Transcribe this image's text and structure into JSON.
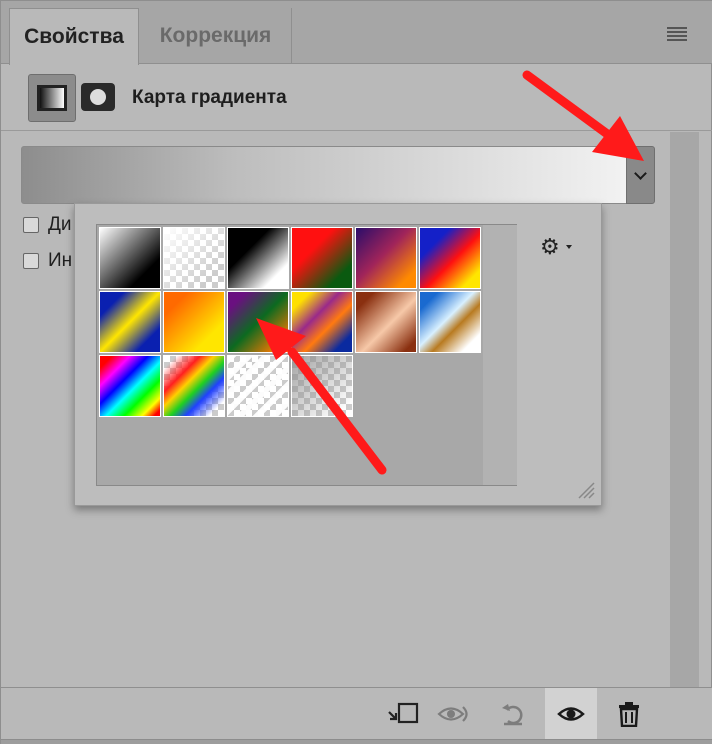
{
  "tabs": [
    {
      "label": "Свойства",
      "active": true
    },
    {
      "label": "Коррекция",
      "active": false
    }
  ],
  "header": {
    "title": "Карта градиента",
    "adjustment_icon": "gradient-map-icon",
    "mask_icon": "mask-icon"
  },
  "gradient": {
    "preview_colors": [
      "#8d8d8d",
      "#f2f2f2"
    ]
  },
  "options": [
    {
      "label": "Ди",
      "checked": false
    },
    {
      "label": "Ин",
      "checked": false
    }
  ],
  "presets": [
    {
      "name": "black-white",
      "css": "linear-gradient(135deg, #fff 0%, #000 75%)"
    },
    {
      "name": "white-transparent",
      "css": "linear-gradient(135deg, #fff 0%, rgba(255,255,255,0) 80%)",
      "checker": true
    },
    {
      "name": "black-white-2",
      "css": "linear-gradient(135deg, #000 35%, #fff 80%)"
    },
    {
      "name": "red-green",
      "css": "linear-gradient(135deg, #ff1010 35%, #0a5a10 80%)"
    },
    {
      "name": "violet-orange",
      "css": "linear-gradient(135deg, #2a0d6a 0%, #a0245a 45%, #ff8a00 85%)"
    },
    {
      "name": "blue-red-yellow",
      "css": "linear-gradient(135deg, #1420c8 25%, #ff1010 55%, #ffe600 85%)"
    },
    {
      "name": "blue-yellow-blue",
      "css": "linear-gradient(135deg, #0a20b0 20%, #ffe600 50%, #0a20b0 80%)"
    },
    {
      "name": "orange-yellow",
      "css": "linear-gradient(135deg, #ff6a00 20%, #ffe600 75%)"
    },
    {
      "name": "violet-green-orange",
      "css": "linear-gradient(135deg, #6a1080 15%, #0c6a20 50%, #ff7a00 90%)"
    },
    {
      "name": "yellow-violet-orange-blue",
      "css": "linear-gradient(135deg, #ffe000 15%, #9a2a8a 40%, #ff7a10 60%, #0a2aa0 85%)"
    },
    {
      "name": "copper",
      "css": "linear-gradient(135deg, #8a3010 15%, #f6c8a8 55%, #8a3010 90%)"
    },
    {
      "name": "chrome",
      "css": "linear-gradient(135deg, #1a6ad0 15%, #d8f0ff 45%, #b87a20 60%, #fff 85%)"
    },
    {
      "name": "spectrum",
      "css": "linear-gradient(135deg, #ff0000 10%, #ff00ff 25%, #0000ff 40%, #00ffff 55%, #00ff00 70%, #ffff00 85%, #ff0000 95%)"
    },
    {
      "name": "transparent-rainbow",
      "css": "linear-gradient(135deg, rgba(255,0,0,0) 10%, #ff2020 30%, #ffd000 42%, #20d020 55%, #2040ff 68%, rgba(0,0,255,0) 88%)",
      "checker": true
    },
    {
      "name": "transparent-stripes",
      "css": "repeating-linear-gradient(135deg, rgba(255,255,255,0.95) 0 6px, rgba(255,255,255,0) 6px 12px)",
      "checker": true
    },
    {
      "name": "neutral-density",
      "css": "linear-gradient(135deg, rgba(140,140,140,0.8) 0%, rgba(140,140,140,0) 90%)",
      "checker": true
    }
  ],
  "popup": {
    "settings_icon": "gear-icon"
  },
  "toolbar": {
    "buttons": [
      "clip-to-layer-icon",
      "view-previous-state-icon",
      "reset-icon",
      "visibility-eye-icon",
      "trash-icon"
    ]
  },
  "annotation_color": "#ff1a1a"
}
